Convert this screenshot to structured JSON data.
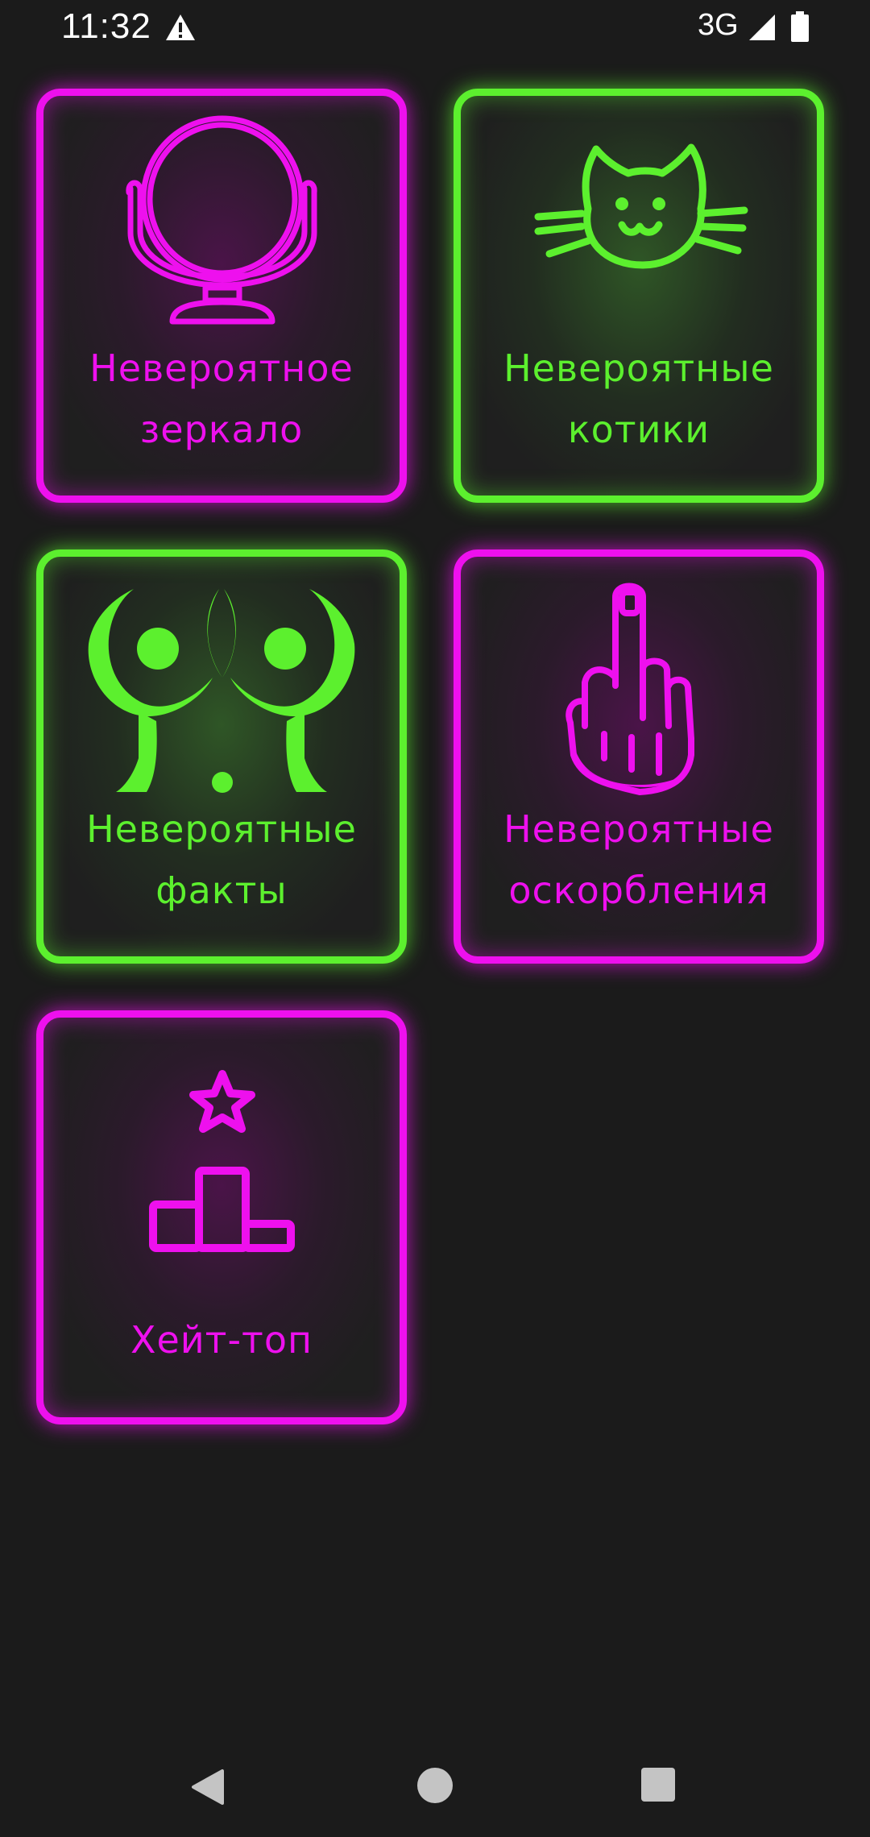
{
  "status_bar": {
    "time": "11:32",
    "network": "3G",
    "icons": [
      "warning-icon",
      "signal-icon",
      "battery-icon"
    ]
  },
  "tiles": [
    {
      "label_line1": "Невероятное",
      "label_line2": "зеркало",
      "icon": "mirror-icon",
      "color": "#ee10ee"
    },
    {
      "label_line1": "Невероятные",
      "label_line2": "котики",
      "icon": "cat-icon",
      "color": "#5cf02e"
    },
    {
      "label_line1": "Невероятные",
      "label_line2": "факты",
      "icon": "facts-icon",
      "color": "#5cf02e"
    },
    {
      "label_line1": "Невероятные",
      "label_line2": "оскорбления",
      "icon": "middle-finger-icon",
      "color": "#ee10ee"
    },
    {
      "label_line1": "Хейт-топ",
      "icon": "podium-star-icon",
      "color": "#ee10ee"
    }
  ],
  "nav_bar": {
    "icons": [
      "back-icon",
      "home-icon",
      "recents-icon"
    ]
  },
  "colors": {
    "background": "#1b1b1b",
    "pink": "#ee10ee",
    "green": "#5cf02e"
  }
}
